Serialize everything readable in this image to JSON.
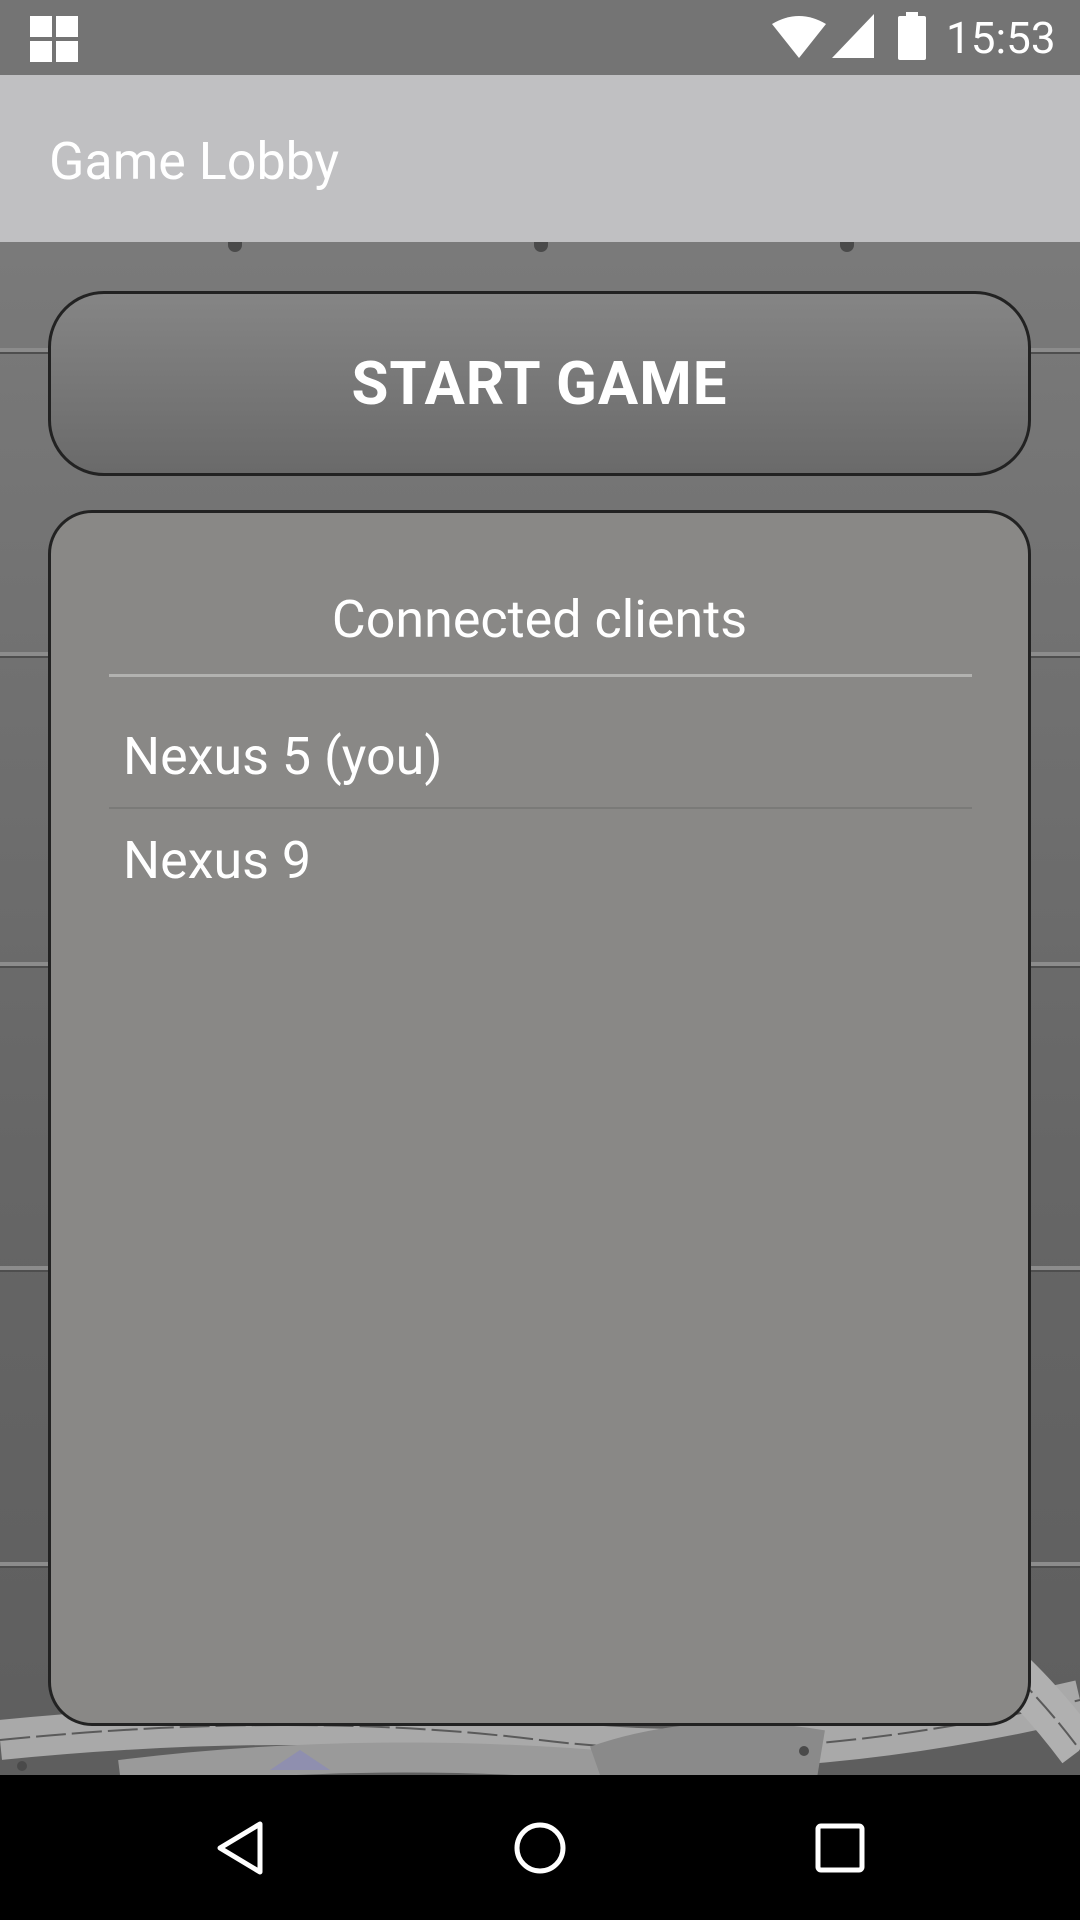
{
  "status_bar": {
    "time": "15:53",
    "icons": [
      "notification-grid-icon",
      "wifi-icon",
      "cell-signal-icon",
      "battery-icon"
    ],
    "background_color": "#747474"
  },
  "app_bar": {
    "title": "Game Lobby",
    "background_color": "#c0c0c2"
  },
  "start_button": {
    "label": "START GAME"
  },
  "clients_panel": {
    "title": "Connected clients",
    "clients": [
      {
        "label": "Nexus 5 (you)"
      },
      {
        "label": "Nexus 9"
      }
    ],
    "background_color": "#898886"
  },
  "nav_bar": {
    "buttons": [
      "back-icon",
      "home-icon",
      "recents-icon"
    ]
  }
}
